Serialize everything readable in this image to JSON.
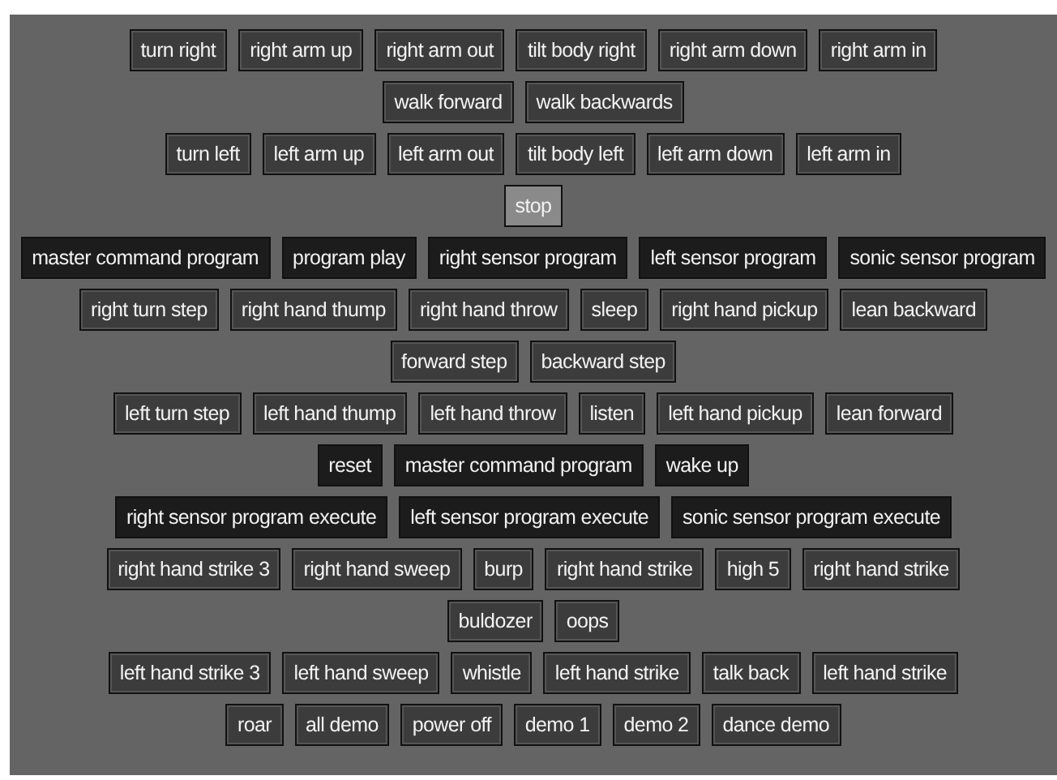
{
  "rows": [
    [
      {
        "label": "turn right",
        "kind": "motion"
      },
      {
        "label": "right arm up",
        "kind": "motion"
      },
      {
        "label": "right arm out",
        "kind": "motion"
      },
      {
        "label": "tilt body right",
        "kind": "motion"
      },
      {
        "label": "right arm down",
        "kind": "motion"
      },
      {
        "label": "right arm in",
        "kind": "motion"
      }
    ],
    [
      {
        "label": "walk forward",
        "kind": "motion"
      },
      {
        "label": "walk backwards",
        "kind": "motion"
      }
    ],
    [
      {
        "label": "turn left",
        "kind": "motion"
      },
      {
        "label": "left arm up",
        "kind": "motion"
      },
      {
        "label": "left arm out",
        "kind": "motion"
      },
      {
        "label": "tilt body left",
        "kind": "motion"
      },
      {
        "label": "left arm down",
        "kind": "motion"
      },
      {
        "label": "left arm in",
        "kind": "motion"
      }
    ],
    [
      {
        "label": "stop",
        "kind": "stop"
      }
    ],
    [
      {
        "label": "master command program",
        "kind": "program"
      },
      {
        "label": "program play",
        "kind": "program"
      },
      {
        "label": "right sensor program",
        "kind": "program"
      },
      {
        "label": "left sensor program",
        "kind": "program"
      },
      {
        "label": "sonic sensor program",
        "kind": "program"
      }
    ],
    [
      {
        "label": "right turn step",
        "kind": "motion"
      },
      {
        "label": "right hand thump",
        "kind": "motion"
      },
      {
        "label": "right hand throw",
        "kind": "motion"
      },
      {
        "label": "sleep",
        "kind": "motion"
      },
      {
        "label": "right hand pickup",
        "kind": "motion"
      },
      {
        "label": "lean backward",
        "kind": "motion"
      }
    ],
    [
      {
        "label": "forward step",
        "kind": "motion"
      },
      {
        "label": "backward step",
        "kind": "motion"
      }
    ],
    [
      {
        "label": "left turn step",
        "kind": "motion"
      },
      {
        "label": "left hand thump",
        "kind": "motion"
      },
      {
        "label": "left hand throw",
        "kind": "motion"
      },
      {
        "label": "listen",
        "kind": "motion"
      },
      {
        "label": "left hand pickup",
        "kind": "motion"
      },
      {
        "label": "lean forward",
        "kind": "motion"
      }
    ],
    [
      {
        "label": "reset",
        "kind": "program"
      },
      {
        "label": "master command program",
        "kind": "program"
      },
      {
        "label": "wake up",
        "kind": "program"
      }
    ],
    [
      {
        "label": "right sensor program execute",
        "kind": "program"
      },
      {
        "label": "left sensor program execute",
        "kind": "program"
      },
      {
        "label": "sonic sensor program execute",
        "kind": "program"
      }
    ],
    [
      {
        "label": "right hand strike 3",
        "kind": "motion"
      },
      {
        "label": "right hand sweep",
        "kind": "motion"
      },
      {
        "label": "burp",
        "kind": "motion"
      },
      {
        "label": "right hand strike",
        "kind": "motion"
      },
      {
        "label": "high 5",
        "kind": "motion"
      },
      {
        "label": "right hand strike",
        "kind": "motion"
      }
    ],
    [
      {
        "label": "buldozer",
        "kind": "motion"
      },
      {
        "label": "oops",
        "kind": "motion"
      }
    ],
    [
      {
        "label": "left hand strike 3",
        "kind": "motion"
      },
      {
        "label": "left hand sweep",
        "kind": "motion"
      },
      {
        "label": "whistle",
        "kind": "motion"
      },
      {
        "label": "left hand strike",
        "kind": "motion"
      },
      {
        "label": "talk back",
        "kind": "motion"
      },
      {
        "label": "left hand strike",
        "kind": "motion"
      }
    ],
    [
      {
        "label": "roar",
        "kind": "motion"
      },
      {
        "label": "all demo",
        "kind": "motion"
      },
      {
        "label": "power off",
        "kind": "motion"
      },
      {
        "label": "demo 1",
        "kind": "motion"
      },
      {
        "label": "demo 2",
        "kind": "motion"
      },
      {
        "label": "dance demo",
        "kind": "motion"
      }
    ]
  ]
}
